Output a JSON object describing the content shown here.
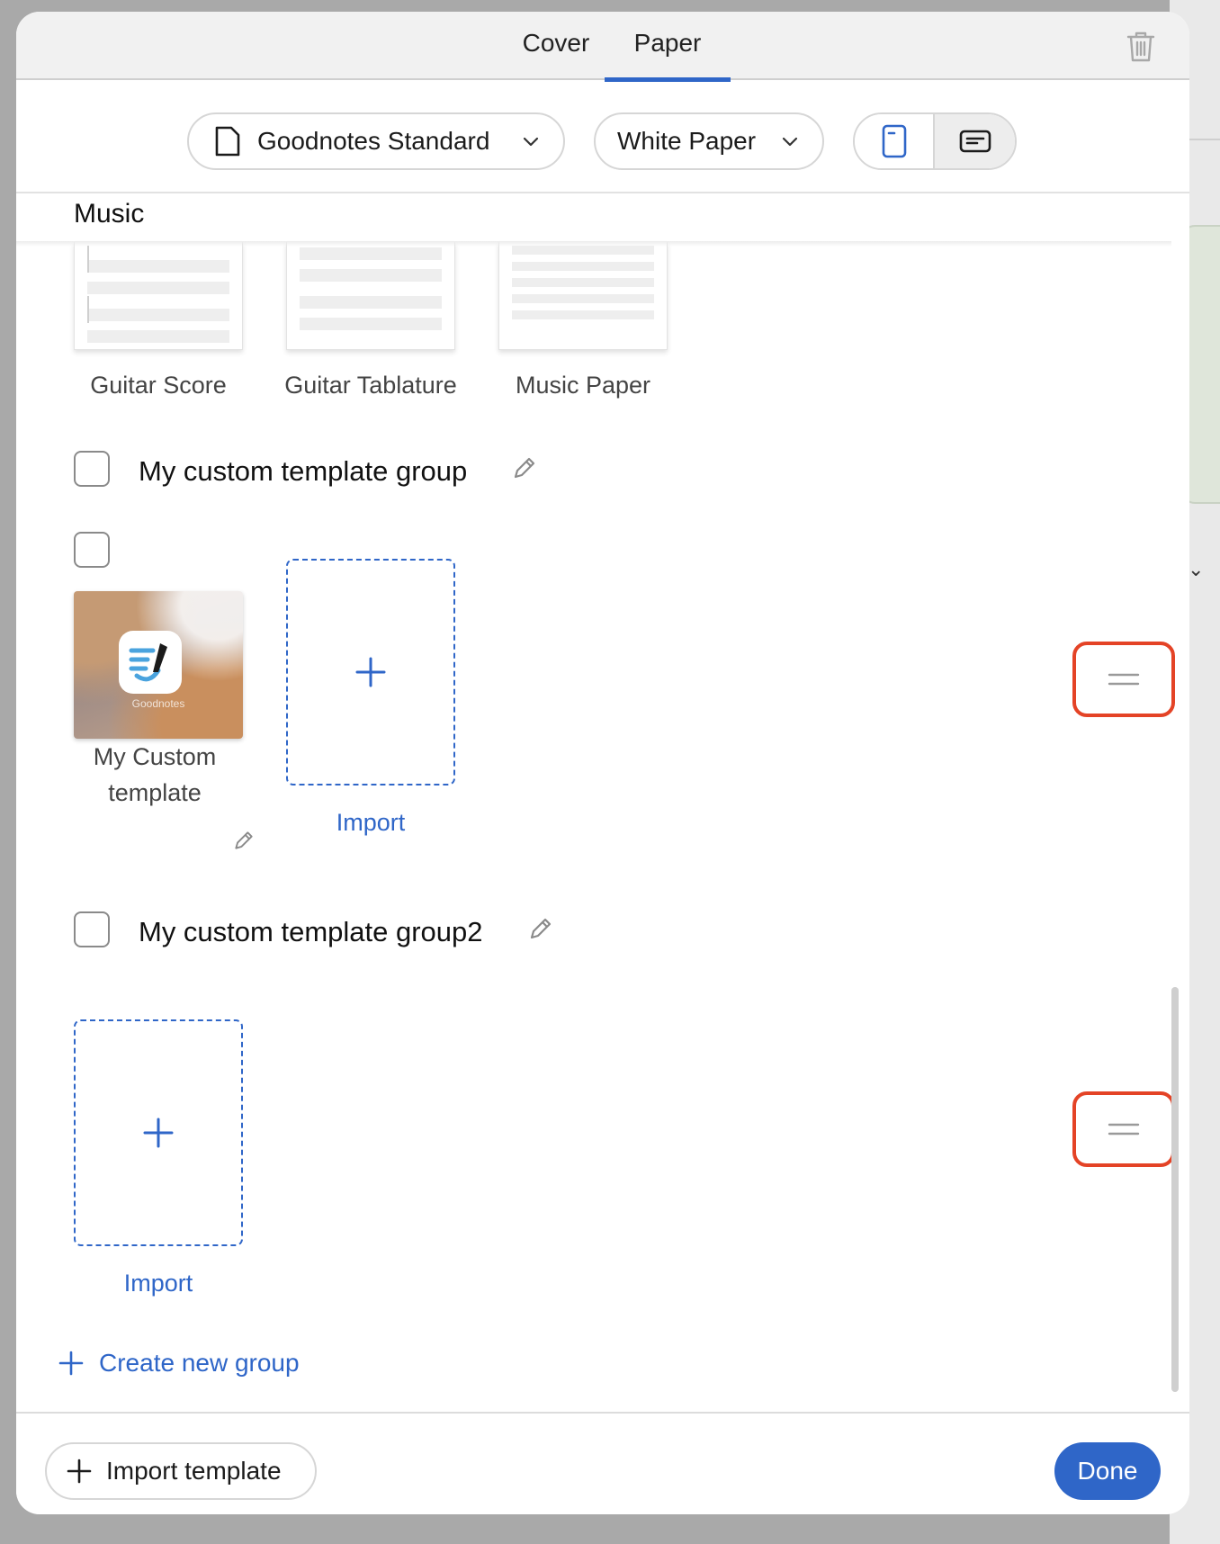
{
  "tabs": [
    {
      "label": "Cover",
      "active": false
    },
    {
      "label": "Paper",
      "active": true
    }
  ],
  "toolbar": {
    "template_set": "Goodnotes Standard",
    "paper_color": "White Paper",
    "orientation_selected": "landscape"
  },
  "section": {
    "header": "Music",
    "templates": [
      {
        "label": "Guitar Score"
      },
      {
        "label": "Guitar Tablature"
      },
      {
        "label": "Music Paper"
      }
    ]
  },
  "groups": [
    {
      "title": "My custom template group",
      "templates": [
        {
          "label_line1": "My Custom",
          "label_line2": "template",
          "icon": "goodnotes-app-icon",
          "brand": "Goodnotes"
        }
      ],
      "import_label": "Import"
    },
    {
      "title": "My custom template group2",
      "templates": [],
      "import_label": "Import"
    }
  ],
  "create_group_label": "Create new group",
  "footer": {
    "import_template_label": "Import template",
    "done_label": "Done"
  },
  "colors": {
    "accent": "#2f66c8",
    "highlight": "#e44326"
  }
}
